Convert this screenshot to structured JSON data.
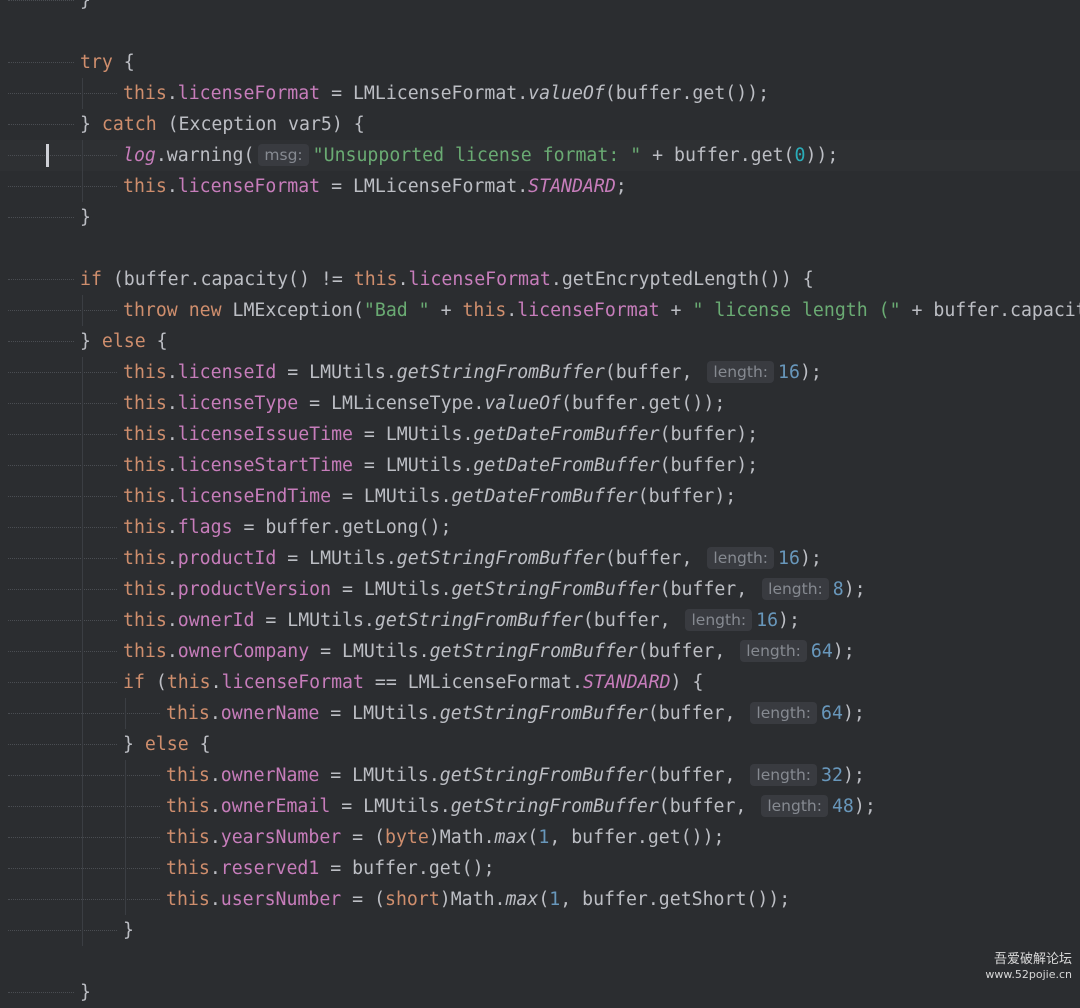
{
  "code": {
    "lines": [
      {
        "indent": 0,
        "seg": [
          [
            "p",
            "}"
          ]
        ]
      },
      {
        "indent": 0,
        "seg": []
      },
      {
        "indent": 1,
        "seg": [
          [
            "kw",
            "try"
          ],
          [
            "p",
            " {"
          ]
        ]
      },
      {
        "indent": 2,
        "seg": [
          [
            "kw",
            "this"
          ],
          [
            "p",
            "."
          ],
          [
            "fld",
            "licenseFormat"
          ],
          [
            "p",
            " = LMLicenseFormat."
          ],
          [
            "it",
            "valueOf"
          ],
          [
            "p",
            "(buffer.get());"
          ]
        ]
      },
      {
        "indent": 1,
        "seg": [
          [
            "p",
            "} "
          ],
          [
            "kw",
            "catch"
          ],
          [
            "p",
            " (Exception var5) {"
          ]
        ]
      },
      {
        "indent": 2,
        "caret": true,
        "seg": [
          [
            "fld it",
            "log"
          ],
          [
            "p",
            ".warning("
          ],
          [
            "hint",
            "msg:"
          ],
          [
            "str",
            "\"Unsupported license format: \""
          ],
          [
            "p",
            " + buffer.get("
          ],
          [
            "num",
            "0"
          ],
          [
            "p",
            "));"
          ]
        ]
      },
      {
        "indent": 2,
        "seg": [
          [
            "kw",
            "this"
          ],
          [
            "p",
            "."
          ],
          [
            "fld",
            "licenseFormat"
          ],
          [
            "p",
            " = LMLicenseFormat."
          ],
          [
            "sfld",
            "STANDARD"
          ],
          [
            "p",
            ";"
          ]
        ]
      },
      {
        "indent": 1,
        "seg": [
          [
            "p",
            "}"
          ]
        ]
      },
      {
        "indent": 0,
        "seg": []
      },
      {
        "indent": 1,
        "seg": [
          [
            "kw",
            "if"
          ],
          [
            "p",
            " (buffer.capacity() != "
          ],
          [
            "kw",
            "this"
          ],
          [
            "p",
            "."
          ],
          [
            "fld",
            "licenseFormat"
          ],
          [
            "p",
            ".getEncryptedLength()) {"
          ]
        ]
      },
      {
        "indent": 2,
        "seg": [
          [
            "kw",
            "throw new"
          ],
          [
            "p",
            " LMException("
          ],
          [
            "str",
            "\"Bad \""
          ],
          [
            "p",
            " + "
          ],
          [
            "kw",
            "this"
          ],
          [
            "p",
            "."
          ],
          [
            "fld",
            "licenseFormat"
          ],
          [
            "p",
            " + "
          ],
          [
            "str",
            "\" license length (\""
          ],
          [
            "p",
            " + buffer.capacity("
          ]
        ]
      },
      {
        "indent": 1,
        "seg": [
          [
            "p",
            "} "
          ],
          [
            "kw",
            "else"
          ],
          [
            "p",
            " {"
          ]
        ]
      },
      {
        "indent": 2,
        "seg": [
          [
            "kw",
            "this"
          ],
          [
            "p",
            "."
          ],
          [
            "fld",
            "licenseId"
          ],
          [
            "p",
            " = LMUtils."
          ],
          [
            "it",
            "getStringFromBuffer"
          ],
          [
            "p",
            "(buffer, "
          ],
          [
            "hint",
            "length:"
          ],
          [
            "num2",
            "16"
          ],
          [
            "p",
            ");"
          ]
        ]
      },
      {
        "indent": 2,
        "seg": [
          [
            "kw",
            "this"
          ],
          [
            "p",
            "."
          ],
          [
            "fld",
            "licenseType"
          ],
          [
            "p",
            " = LMLicenseType."
          ],
          [
            "it",
            "valueOf"
          ],
          [
            "p",
            "(buffer.get());"
          ]
        ]
      },
      {
        "indent": 2,
        "seg": [
          [
            "kw",
            "this"
          ],
          [
            "p",
            "."
          ],
          [
            "fld",
            "licenseIssueTime"
          ],
          [
            "p",
            " = LMUtils."
          ],
          [
            "it",
            "getDateFromBuffer"
          ],
          [
            "p",
            "(buffer);"
          ]
        ]
      },
      {
        "indent": 2,
        "seg": [
          [
            "kw",
            "this"
          ],
          [
            "p",
            "."
          ],
          [
            "fld",
            "licenseStartTime"
          ],
          [
            "p",
            " = LMUtils."
          ],
          [
            "it",
            "getDateFromBuffer"
          ],
          [
            "p",
            "(buffer);"
          ]
        ]
      },
      {
        "indent": 2,
        "seg": [
          [
            "kw",
            "this"
          ],
          [
            "p",
            "."
          ],
          [
            "fld",
            "licenseEndTime"
          ],
          [
            "p",
            " = LMUtils."
          ],
          [
            "it",
            "getDateFromBuffer"
          ],
          [
            "p",
            "(buffer);"
          ]
        ]
      },
      {
        "indent": 2,
        "seg": [
          [
            "kw",
            "this"
          ],
          [
            "p",
            "."
          ],
          [
            "fld",
            "flags"
          ],
          [
            "p",
            " = buffer.getLong();"
          ]
        ]
      },
      {
        "indent": 2,
        "seg": [
          [
            "kw",
            "this"
          ],
          [
            "p",
            "."
          ],
          [
            "fld",
            "productId"
          ],
          [
            "p",
            " = LMUtils."
          ],
          [
            "it",
            "getStringFromBuffer"
          ],
          [
            "p",
            "(buffer, "
          ],
          [
            "hint",
            "length:"
          ],
          [
            "num2",
            "16"
          ],
          [
            "p",
            ");"
          ]
        ]
      },
      {
        "indent": 2,
        "seg": [
          [
            "kw",
            "this"
          ],
          [
            "p",
            "."
          ],
          [
            "fld",
            "productVersion"
          ],
          [
            "p",
            " = LMUtils."
          ],
          [
            "it",
            "getStringFromBuffer"
          ],
          [
            "p",
            "(buffer, "
          ],
          [
            "hint",
            "length:"
          ],
          [
            "num2",
            "8"
          ],
          [
            "p",
            ");"
          ]
        ]
      },
      {
        "indent": 2,
        "seg": [
          [
            "kw",
            "this"
          ],
          [
            "p",
            "."
          ],
          [
            "fld",
            "ownerId"
          ],
          [
            "p",
            " = LMUtils."
          ],
          [
            "it",
            "getStringFromBuffer"
          ],
          [
            "p",
            "(buffer, "
          ],
          [
            "hint",
            "length:"
          ],
          [
            "num2",
            "16"
          ],
          [
            "p",
            ");"
          ]
        ]
      },
      {
        "indent": 2,
        "seg": [
          [
            "kw",
            "this"
          ],
          [
            "p",
            "."
          ],
          [
            "fld",
            "ownerCompany"
          ],
          [
            "p",
            " = LMUtils."
          ],
          [
            "it",
            "getStringFromBuffer"
          ],
          [
            "p",
            "(buffer, "
          ],
          [
            "hint",
            "length:"
          ],
          [
            "num2",
            "64"
          ],
          [
            "p",
            ");"
          ]
        ]
      },
      {
        "indent": 2,
        "seg": [
          [
            "kw",
            "if"
          ],
          [
            "p",
            " ("
          ],
          [
            "kw",
            "this"
          ],
          [
            "p",
            "."
          ],
          [
            "fld",
            "licenseFormat"
          ],
          [
            "p",
            " == LMLicenseFormat."
          ],
          [
            "sfld",
            "STANDARD"
          ],
          [
            "p",
            ") {"
          ]
        ]
      },
      {
        "indent": 3,
        "seg": [
          [
            "kw",
            "this"
          ],
          [
            "p",
            "."
          ],
          [
            "fld",
            "ownerName"
          ],
          [
            "p",
            " = LMUtils."
          ],
          [
            "it",
            "getStringFromBuffer"
          ],
          [
            "p",
            "(buffer, "
          ],
          [
            "hint",
            "length:"
          ],
          [
            "num2",
            "64"
          ],
          [
            "p",
            ");"
          ]
        ]
      },
      {
        "indent": 2,
        "seg": [
          [
            "p",
            "} "
          ],
          [
            "kw",
            "else"
          ],
          [
            "p",
            " {"
          ]
        ]
      },
      {
        "indent": 3,
        "seg": [
          [
            "kw",
            "this"
          ],
          [
            "p",
            "."
          ],
          [
            "fld",
            "ownerName"
          ],
          [
            "p",
            " = LMUtils."
          ],
          [
            "it",
            "getStringFromBuffer"
          ],
          [
            "p",
            "(buffer, "
          ],
          [
            "hint",
            "length:"
          ],
          [
            "num2",
            "32"
          ],
          [
            "p",
            ");"
          ]
        ]
      },
      {
        "indent": 3,
        "seg": [
          [
            "kw",
            "this"
          ],
          [
            "p",
            "."
          ],
          [
            "fld",
            "ownerEmail"
          ],
          [
            "p",
            " = LMUtils."
          ],
          [
            "it",
            "getStringFromBuffer"
          ],
          [
            "p",
            "(buffer, "
          ],
          [
            "hint",
            "length:"
          ],
          [
            "num2",
            "48"
          ],
          [
            "p",
            ");"
          ]
        ]
      },
      {
        "indent": 3,
        "seg": [
          [
            "kw",
            "this"
          ],
          [
            "p",
            "."
          ],
          [
            "fld",
            "yearsNumber"
          ],
          [
            "p",
            " = ("
          ],
          [
            "kw",
            "byte"
          ],
          [
            "p",
            ")Math."
          ],
          [
            "it",
            "max"
          ],
          [
            "p",
            "("
          ],
          [
            "num2",
            "1"
          ],
          [
            "p",
            ", buffer.get());"
          ]
        ]
      },
      {
        "indent": 3,
        "seg": [
          [
            "kw",
            "this"
          ],
          [
            "p",
            "."
          ],
          [
            "fld",
            "reserved1"
          ],
          [
            "p",
            " = buffer.get();"
          ]
        ]
      },
      {
        "indent": 3,
        "seg": [
          [
            "kw",
            "this"
          ],
          [
            "p",
            "."
          ],
          [
            "fld",
            "usersNumber"
          ],
          [
            "p",
            " = ("
          ],
          [
            "kw",
            "short"
          ],
          [
            "p",
            ")Math."
          ],
          [
            "it",
            "max"
          ],
          [
            "p",
            "("
          ],
          [
            "num2",
            "1"
          ],
          [
            "p",
            ", buffer.getShort());"
          ]
        ]
      },
      {
        "indent": 2,
        "seg": [
          [
            "p",
            "}"
          ]
        ]
      },
      {
        "indent": 0,
        "seg": []
      },
      {
        "indent": 1,
        "seg": [
          [
            "p",
            "}"
          ]
        ]
      }
    ]
  },
  "watermark": {
    "site_name": "吾爱破解论坛",
    "url": "www.52pojie.cn"
  }
}
